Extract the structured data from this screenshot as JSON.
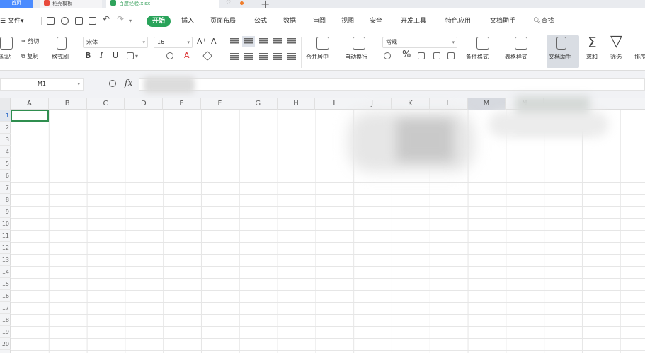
{
  "tabs": {
    "home": "首页",
    "template": "稻壳模板",
    "file": "百度经验.xlsx",
    "new_tab": "+"
  },
  "menu": {
    "file": "文件",
    "items": [
      "开始",
      "插入",
      "页面布局",
      "公式",
      "数据",
      "审阅",
      "视图",
      "安全",
      "开发工具",
      "特色应用",
      "文档助手"
    ],
    "search": "查找",
    "file_arrow": "▾"
  },
  "ribbon": {
    "paste": "粘贴",
    "cut": "剪切",
    "copy": "复制",
    "format_painter": "格式刷",
    "font_name": "宋体",
    "font_size": "16",
    "bold": "B",
    "italic": "I",
    "underline": "U",
    "grow_font": "A⁺",
    "shrink_font": "A⁻",
    "merge_center": "合并居中",
    "wrap_text": "自动换行",
    "number_format": "常规",
    "percent": "%",
    "cond_format": "条件格式",
    "table_style": "表格样式",
    "doc_helper": "文档助手",
    "sum": "求和",
    "filter": "筛选",
    "sort": "排序",
    "sum_icon": "Σ",
    "filter_icon": "▽"
  },
  "formula_bar": {
    "name_box": "M1",
    "fx": "fx"
  },
  "grid": {
    "columns": [
      "A",
      "B",
      "C",
      "D",
      "E",
      "F",
      "G",
      "H",
      "I",
      "J",
      "K",
      "L",
      "M",
      "N"
    ],
    "rows": [
      "1",
      "2",
      "3",
      "4",
      "5",
      "6",
      "7",
      "8",
      "9",
      "10",
      "11",
      "12",
      "13",
      "14",
      "15",
      "16",
      "17",
      "18",
      "19",
      "20"
    ]
  },
  "colors": {
    "accent_green": "#29a35a",
    "home_tab_blue": "#4a8bff",
    "grid_line": "#e6e6e6"
  }
}
